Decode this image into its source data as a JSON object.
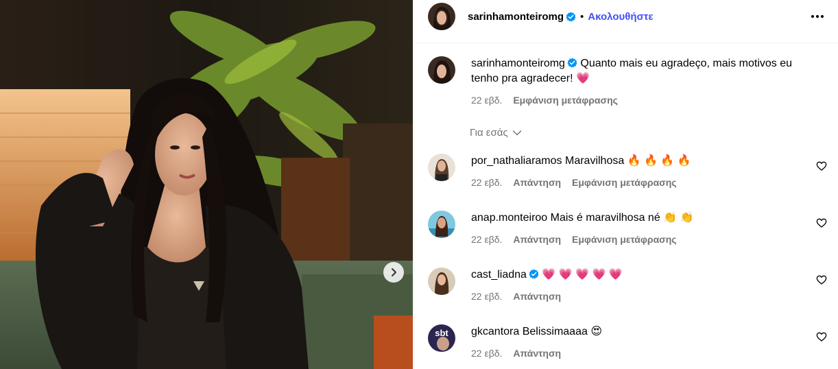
{
  "post": {
    "author": "sarinhamonteiromg",
    "follow_label": "Ακολουθήστε",
    "separator": "•"
  },
  "caption": {
    "username": "sarinhamonteiromg",
    "text": "Quanto mais eu agradeço, mais motivos eu tenho pra agradecer! 💗",
    "age": "22 εβδ.",
    "translate_label": "Εμφάνιση μετάφρασης"
  },
  "filter": {
    "label": "Για εσάς"
  },
  "comments": [
    {
      "username": "por_nathaliaramos",
      "text": "Maravilhosa 🔥 🔥 🔥 🔥",
      "age": "22 εβδ.",
      "reply": "Απάντηση",
      "translate": "Εμφάνιση μετάφρασης",
      "verified": false
    },
    {
      "username": "anap.monteiroo",
      "text": "Mais é maravilhosa né 👏 👏",
      "age": "22 εβδ.",
      "reply": "Απάντηση",
      "translate": "Εμφάνιση μετάφρασης",
      "verified": false
    },
    {
      "username": "cast_liadna",
      "text": "💗 💗 💗 💗 💗",
      "age": "22 εβδ.",
      "reply": "Απάντηση",
      "translate": "",
      "verified": true
    },
    {
      "username": "gkcantora",
      "text": "Belissimaaaa 😍",
      "age": "22 εβδ.",
      "reply": "Απάντηση",
      "translate": "",
      "verified": false
    }
  ],
  "avatar_badges": {
    "gkcantora": "sbt"
  },
  "colors": {
    "follow": "#4150f7",
    "verified": "#0095f6",
    "muted": "#737373",
    "divider": "#efefef"
  },
  "icons": [
    "verified-badge-icon",
    "more-options-icon",
    "chevron-down-icon",
    "heart-outline-icon",
    "chevron-right-icon"
  ]
}
